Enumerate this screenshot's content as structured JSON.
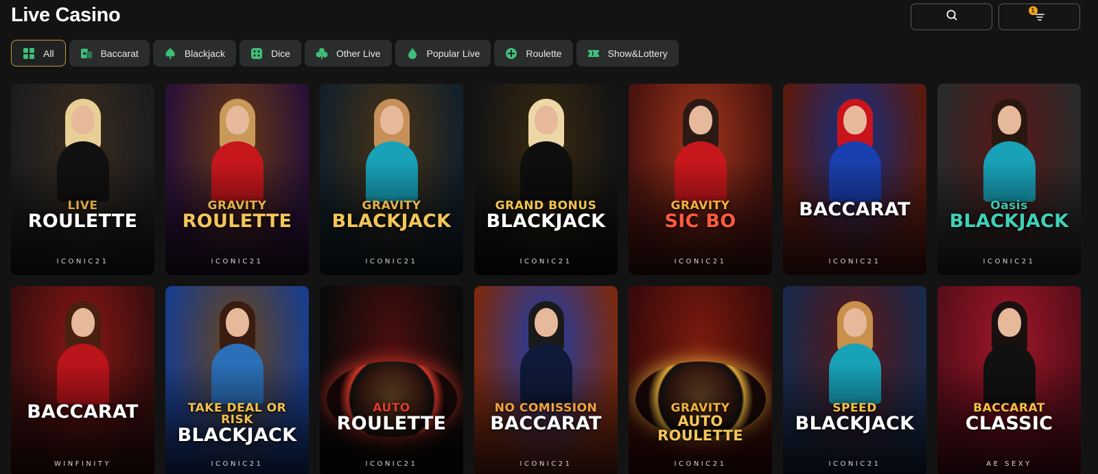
{
  "page_title": "Live Casino",
  "header": {
    "notification_count": "1"
  },
  "categories": [
    {
      "label": "All",
      "icon": "grid-icon",
      "active": true
    },
    {
      "label": "Baccarat",
      "icon": "cards-icon",
      "active": false
    },
    {
      "label": "Blackjack",
      "icon": "spade-icon",
      "active": false
    },
    {
      "label": "Dice",
      "icon": "dice-icon",
      "active": false
    },
    {
      "label": "Other Live",
      "icon": "club-icon",
      "active": false
    },
    {
      "label": "Popular Live",
      "icon": "flame-icon",
      "active": false
    },
    {
      "label": "Roulette",
      "icon": "roulette-plus-icon",
      "active": false
    },
    {
      "label": "Show&Lottery",
      "icon": "ticket-icon",
      "active": false
    }
  ],
  "games": [
    {
      "line1": "LIVE",
      "line2": "ROULETTE",
      "provider": "ICONIC21",
      "bg": "#1c1c1f",
      "bg2": "#3a2c1e",
      "accent": "#d8a542",
      "title_color": "#ffffff",
      "hair": "#e8cf95",
      "dress": "#111111"
    },
    {
      "line1": "GRAVITY",
      "line2": "ROULETTE",
      "provider": "ICONIC21",
      "bg": "#2a1236",
      "bg2": "#6a3a12",
      "accent": "#e3b24a",
      "title_color": "#f4c65a",
      "hair": "#c79a5a",
      "dress": "#c8171c"
    },
    {
      "line1": "GRAVITY",
      "line2": "BLACKJACK",
      "provider": "ICONIC21",
      "bg": "#13202a",
      "bg2": "#4a3314",
      "accent": "#e3b24a",
      "title_color": "#f4c65a",
      "hair": "#c7905a",
      "dress": "#18a2b8"
    },
    {
      "line1": "GRAND BONUS",
      "line2": "BLACKJACK",
      "provider": "ICONIC21",
      "bg": "#141414",
      "bg2": "#3a2a10",
      "accent": "#f0c34a",
      "title_color": "#ffffff",
      "hair": "#eed7a6",
      "dress": "#0e0e0e"
    },
    {
      "line1": "GRAVITY",
      "line2": "SIC BO",
      "provider": "ICONIC21",
      "bg": "#4a1410",
      "bg2": "#a0341a",
      "accent": "#f2b33c",
      "title_color": "#ff5a3c",
      "hair": "#2b1a14",
      "dress": "#c8171c"
    },
    {
      "line1": "",
      "line2": "BACCARAT",
      "provider": "ICONIC21",
      "bg": "#5a1a10",
      "bg2": "#0f2f86",
      "accent": "#f2a33c",
      "title_color": "#ffffff",
      "hair": "#c9141c",
      "dress": "#1a3fae"
    },
    {
      "line1": "Oasis",
      "line2": "BLACKJACK",
      "provider": "ICONIC21",
      "bg": "#2a2a2a",
      "bg2": "#5a1616",
      "accent": "#3ec6b2",
      "title_color": "#3fd1b8",
      "hair": "#2a1810",
      "dress": "#18a2b8"
    },
    {
      "line1": "",
      "line2": "BACCARAT",
      "provider": "WINFINITY",
      "bg": "#3a0e0e",
      "bg2": "#8a1616",
      "accent": "#ffffff",
      "title_color": "#ffffff",
      "hair": "#4a2010",
      "dress": "#b8141a"
    },
    {
      "line1": "TAKE DEAL OR RISK",
      "line2": "BLACKJACK",
      "provider": "ICONIC21",
      "bg": "#1a3d8a",
      "bg2": "#6a4418",
      "accent": "#f2c04a",
      "title_color": "#ffffff",
      "hair": "#3a1c10",
      "dress": "#2a6fb8"
    },
    {
      "line1": "AUTO",
      "line2": "ROULETTE",
      "provider": "ICONIC21",
      "bg": "#0a0a0a",
      "bg2": "#4a0e0e",
      "accent": "#e03a2a",
      "title_color": "#ffffff",
      "hair": "#000000",
      "dress": "#000000"
    },
    {
      "line1": "NO COMISSION",
      "line2": "BACCARAT",
      "provider": "ICONIC21",
      "bg": "#7a2a12",
      "bg2": "#1a3fae",
      "accent": "#f2a33c",
      "title_color": "#ffffff",
      "hair": "#1a1a1a",
      "dress": "#0f1a3a"
    },
    {
      "line1": "GRAVITY",
      "line2": "AUTO ROULETTE",
      "provider": "ICONIC21",
      "bg": "#3a0a0a",
      "bg2": "#7a1a0e",
      "accent": "#f2b33c",
      "title_color": "#f4c65a",
      "hair": "#000000",
      "dress": "#000000"
    },
    {
      "line1": "SPEED",
      "line2": "BLACKJACK",
      "provider": "ICONIC21",
      "bg": "#1a2a4a",
      "bg2": "#5a1616",
      "accent": "#f2c04a",
      "title_color": "#ffffff",
      "hair": "#c8904a",
      "dress": "#18a2b8"
    },
    {
      "line1": "BACCARAT",
      "line2": "CLASSIC",
      "provider": "AE SEXY",
      "bg": "#5a0e1a",
      "bg2": "#a01628",
      "accent": "#f2c04a",
      "title_color": "#ffffff",
      "hair": "#1a1010",
      "dress": "#111111"
    }
  ]
}
